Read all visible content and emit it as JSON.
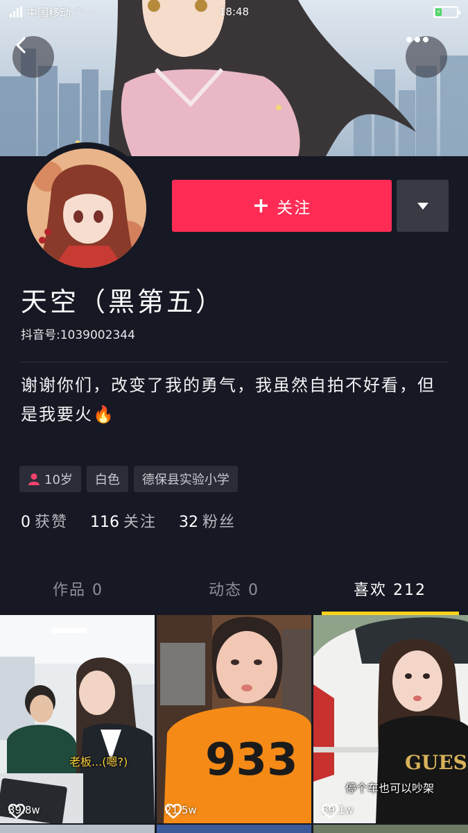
{
  "status_bar": {
    "carrier": "中国移动",
    "time": "18:48"
  },
  "profile": {
    "nickname": "天空（黑第五）",
    "douyin_id": "抖音号:1039002344",
    "follow_label": "关注",
    "bio": "谢谢你们，改变了我的勇气，我虽然自拍不好看，但是我要火🔥",
    "tags": [
      {
        "label": "10岁",
        "icon": "female-icon"
      },
      {
        "label": "白色",
        "icon": ""
      },
      {
        "label": "德保县实验小学",
        "icon": ""
      }
    ],
    "stats": [
      {
        "value": "0",
        "label": "获赞"
      },
      {
        "value": "116",
        "label": "关注"
      },
      {
        "value": "32",
        "label": "粉丝"
      }
    ]
  },
  "tabs": [
    {
      "label": "作品 0",
      "active": false
    },
    {
      "label": "动态 0",
      "active": false
    },
    {
      "label": "喜欢 212",
      "active": true
    }
  ],
  "videos": [
    {
      "likes": "39.8w",
      "caption": "老板...(嗯?)"
    },
    {
      "likes": "21.5w",
      "caption": ""
    },
    {
      "likes": "59.1w",
      "caption": "停个车也可以吵架"
    }
  ],
  "colors": {
    "background": "#161823",
    "follow": "#fe2c55",
    "indicator": "#fdd21b",
    "tag_bg": "#2a2c37"
  },
  "icons": {
    "back": "chevron-left-icon",
    "more": "more-dots-icon",
    "dropdown": "triangle-down-icon",
    "like": "heart-outline-icon"
  }
}
